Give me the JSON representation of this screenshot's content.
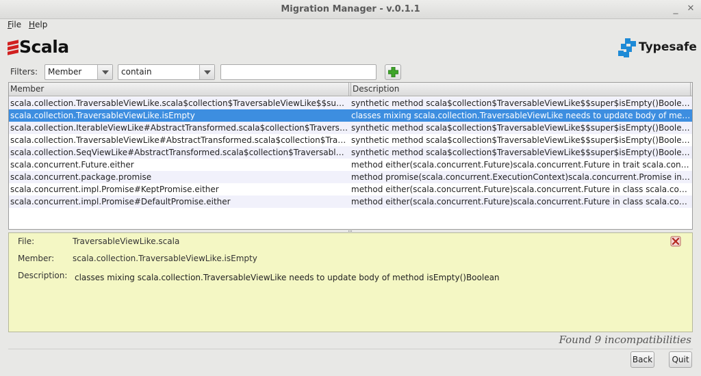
{
  "window": {
    "title": "Migration Manager - v.0.1.1",
    "minimize_glyph": "_",
    "close_glyph": "✕"
  },
  "menu": {
    "items": [
      {
        "label": "File",
        "mnemonic": "F",
        "rest": "ile"
      },
      {
        "label": "Help",
        "mnemonic": "H",
        "rest": "elp"
      }
    ]
  },
  "logos": {
    "left": {
      "text": "Scala",
      "icon": "scala-logo-icon",
      "color": "#d1201f"
    },
    "right": {
      "text": "Typesafe",
      "icon": "typesafe-logo-icon",
      "color": "#1e8ad6"
    }
  },
  "filters": {
    "label": "Filters:",
    "field_selected": "Member",
    "operator_selected": "contain",
    "search_value": "",
    "add_icon": "plus-icon"
  },
  "table": {
    "columns": [
      "Member",
      "Description"
    ],
    "selected_index": 1,
    "rows": [
      {
        "member": "scala.collection.TraversableViewLike.scala$collection$TraversableViewLike$$super$isEmpty",
        "description": "synthetic method scala$collection$TraversableViewLike$$super$isEmpty()Boolean in trait scala.collection.TraversableViewLike does not have a correspondent in old version"
      },
      {
        "member": "scala.collection.TraversableViewLike.isEmpty",
        "description": "classes mixing scala.collection.TraversableViewLike needs to update body of method isEmpty()Boolean"
      },
      {
        "member": "scala.collection.IterableViewLike#AbstractTransformed.scala$collection$TraversableViewLike$$super$isEmpty",
        "description": "synthetic method scala$collection$TraversableViewLike$$super$isEmpty()Boolean in class scala.collection.IterableViewLike#AbstractTransformed"
      },
      {
        "member": "scala.collection.TraversableViewLike#AbstractTransformed.scala$collection$TraversableViewLike$$super$isEmpty",
        "description": "synthetic method scala$collection$TraversableViewLike$$super$isEmpty()Boolean in class scala.collection.TraversableViewLike#AbstractTransformed"
      },
      {
        "member": "scala.collection.SeqViewLike#AbstractTransformed.scala$collection$TraversableViewLike$$super$isEmpty",
        "description": "synthetic method scala$collection$TraversableViewLike$$super$isEmpty()Boolean in class scala.collection.SeqViewLike#AbstractTransformed"
      },
      {
        "member": "scala.concurrent.Future.either",
        "description": "method either(scala.concurrent.Future)scala.concurrent.Future in trait scala.concurrent.Future does not have a correspondent in old version"
      },
      {
        "member": "scala.concurrent.package.promise",
        "description": "method promise(scala.concurrent.ExecutionContext)scala.concurrent.Promise in object scala.concurrent.package"
      },
      {
        "member": "scala.concurrent.impl.Promise#KeptPromise.either",
        "description": "method either(scala.concurrent.Future)scala.concurrent.Future in class scala.concurrent.impl.Promise#KeptPromise"
      },
      {
        "member": "scala.concurrent.impl.Promise#DefaultPromise.either",
        "description": "method either(scala.concurrent.Future)scala.concurrent.Future in class scala.concurrent.impl.Promise#DefaultPromise"
      }
    ]
  },
  "details": {
    "file_label": "File:",
    "file_value": "TraversableViewLike.scala",
    "member_label": "Member:",
    "member_value": "scala.collection.TraversableViewLike.isEmpty",
    "description_label": "Description:",
    "description_value": "classes mixing scala.collection.TraversableViewLike needs to update body of method isEmpty()Boolean",
    "close_icon": "red-x-close-icon"
  },
  "status": {
    "text": "Found 9 incompatibilities"
  },
  "buttons": {
    "back": "Back",
    "quit": "Quit"
  }
}
